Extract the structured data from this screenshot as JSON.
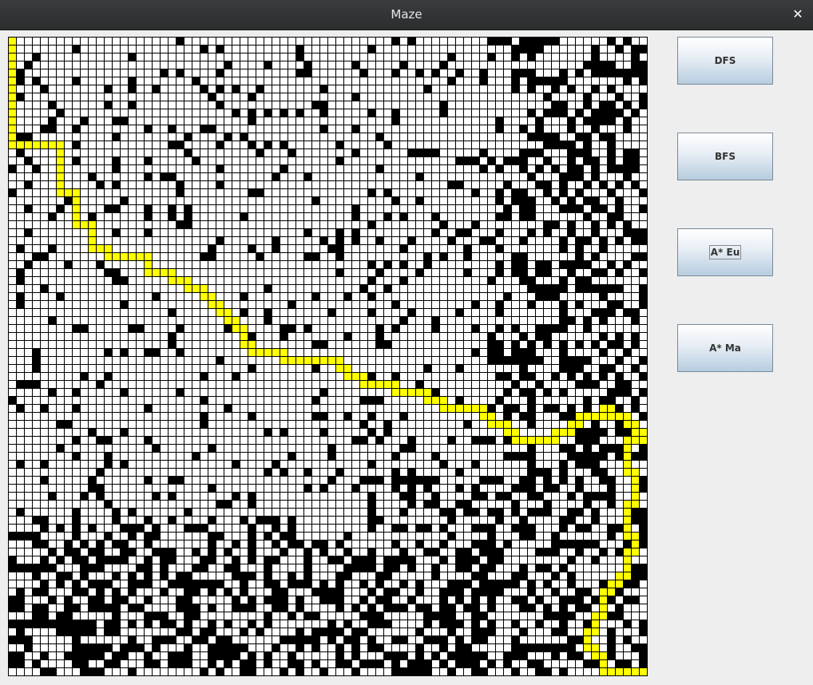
{
  "window": {
    "title": "Maze",
    "close_label": "✕"
  },
  "buttons": [
    {
      "label": "DFS"
    },
    {
      "label": "BFS"
    },
    {
      "label": "A* Eu",
      "focused": true
    },
    {
      "label": "A* Ma"
    }
  ],
  "maze": {
    "rows": 80,
    "cols": 80,
    "colors": {
      "wall": "#000000",
      "open": "#ffffff",
      "grid": "#000000",
      "path": "#ffff00"
    },
    "start": [
      0,
      0
    ],
    "goal": [
      79,
      79
    ],
    "path_waypoints": [
      [
        0,
        0
      ],
      [
        13,
        0
      ],
      [
        13,
        6
      ],
      [
        19,
        6
      ],
      [
        19,
        8
      ],
      [
        23,
        8
      ],
      [
        23,
        10
      ],
      [
        26,
        10
      ],
      [
        26,
        12
      ],
      [
        27,
        12
      ],
      [
        27,
        17
      ],
      [
        29,
        17
      ],
      [
        29,
        20
      ],
      [
        30,
        20
      ],
      [
        30,
        22
      ],
      [
        31,
        22
      ],
      [
        31,
        24
      ],
      [
        32,
        24
      ],
      [
        32,
        25
      ],
      [
        33,
        25
      ],
      [
        33,
        26
      ],
      [
        34,
        26
      ],
      [
        34,
        27
      ],
      [
        35,
        27
      ],
      [
        35,
        28
      ],
      [
        36,
        28
      ],
      [
        36,
        29
      ],
      [
        38,
        29
      ],
      [
        38,
        30
      ],
      [
        39,
        30
      ],
      [
        39,
        34
      ],
      [
        40,
        34
      ],
      [
        40,
        41
      ],
      [
        41,
        41
      ],
      [
        41,
        42
      ],
      [
        42,
        42
      ],
      [
        42,
        44
      ],
      [
        43,
        44
      ],
      [
        43,
        48
      ],
      [
        44,
        48
      ],
      [
        44,
        52
      ],
      [
        45,
        52
      ],
      [
        45,
        54
      ],
      [
        46,
        54
      ],
      [
        46,
        59
      ],
      [
        47,
        59
      ],
      [
        47,
        60
      ],
      [
        48,
        60
      ],
      [
        48,
        62
      ],
      [
        49,
        62
      ],
      [
        49,
        63
      ],
      [
        50,
        63
      ],
      [
        50,
        68
      ],
      [
        49,
        68
      ],
      [
        49,
        70
      ],
      [
        48,
        70
      ],
      [
        48,
        71
      ],
      [
        47,
        71
      ],
      [
        47,
        74
      ],
      [
        46,
        74
      ],
      [
        46,
        75
      ],
      [
        47,
        75
      ],
      [
        47,
        77
      ],
      [
        48,
        77
      ],
      [
        48,
        78
      ],
      [
        49,
        78
      ],
      [
        49,
        79
      ],
      [
        50,
        79
      ],
      [
        50,
        77
      ],
      [
        54,
        77
      ],
      [
        54,
        78
      ],
      [
        58,
        78
      ],
      [
        58,
        77
      ],
      [
        62,
        77
      ],
      [
        62,
        78
      ],
      [
        64,
        78
      ],
      [
        64,
        77
      ],
      [
        67,
        77
      ],
      [
        67,
        76
      ],
      [
        68,
        76
      ],
      [
        68,
        75
      ],
      [
        69,
        75
      ],
      [
        69,
        74
      ],
      [
        72,
        74
      ],
      [
        72,
        73
      ],
      [
        74,
        73
      ],
      [
        74,
        72
      ],
      [
        76,
        72
      ],
      [
        76,
        73
      ],
      [
        77,
        73
      ],
      [
        77,
        74
      ],
      [
        79,
        74
      ],
      [
        79,
        79
      ]
    ],
    "density": {
      "top_left": 0.12,
      "right_band": 0.45,
      "bottom_band": 0.45
    }
  }
}
